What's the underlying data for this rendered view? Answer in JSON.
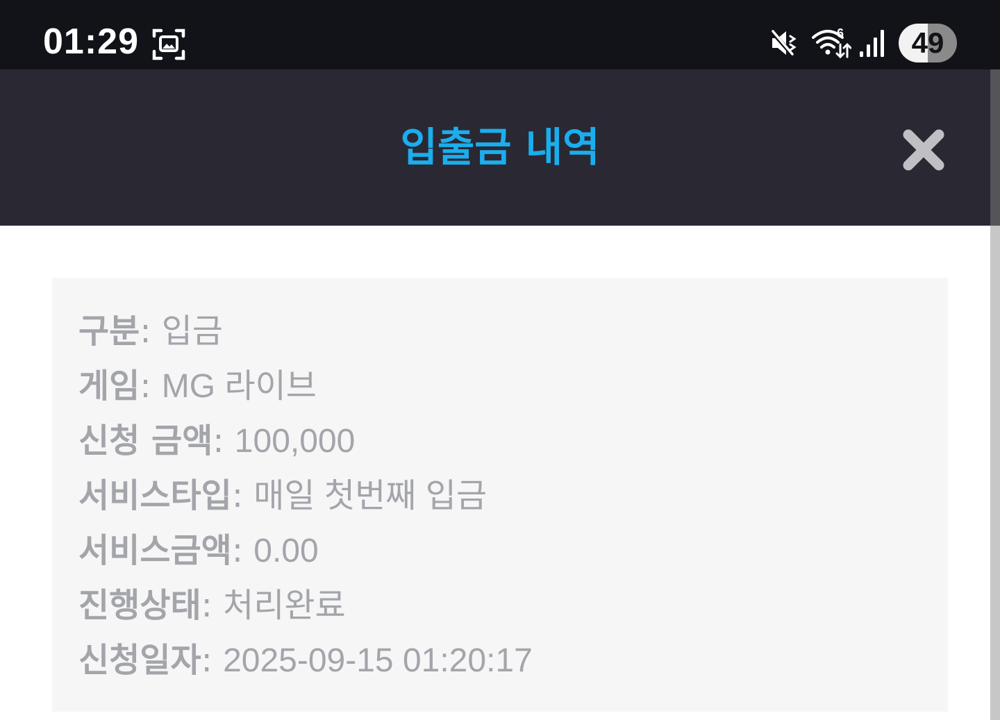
{
  "status_bar": {
    "time": "01:29",
    "battery": "49",
    "icons": [
      "screenshot-icon",
      "mute-icon",
      "wifi-icon",
      "signal-icon"
    ]
  },
  "header": {
    "title": "입출금 내역",
    "title_color": "#1aaeee",
    "close_icon": "close-icon"
  },
  "details": {
    "separator": ": ",
    "rows": [
      {
        "label": "구분",
        "value": "입금"
      },
      {
        "label": "게임",
        "value": "MG 라이브"
      },
      {
        "label": "신청 금액",
        "value": "100,000"
      },
      {
        "label": "서비스타입",
        "value": "매일 첫번째 입금"
      },
      {
        "label": "서비스금액",
        "value": "0.00"
      },
      {
        "label": "진행상태",
        "value": "처리완료"
      },
      {
        "label": "신청일자",
        "value": "2025-09-15 01:20:17"
      }
    ]
  }
}
